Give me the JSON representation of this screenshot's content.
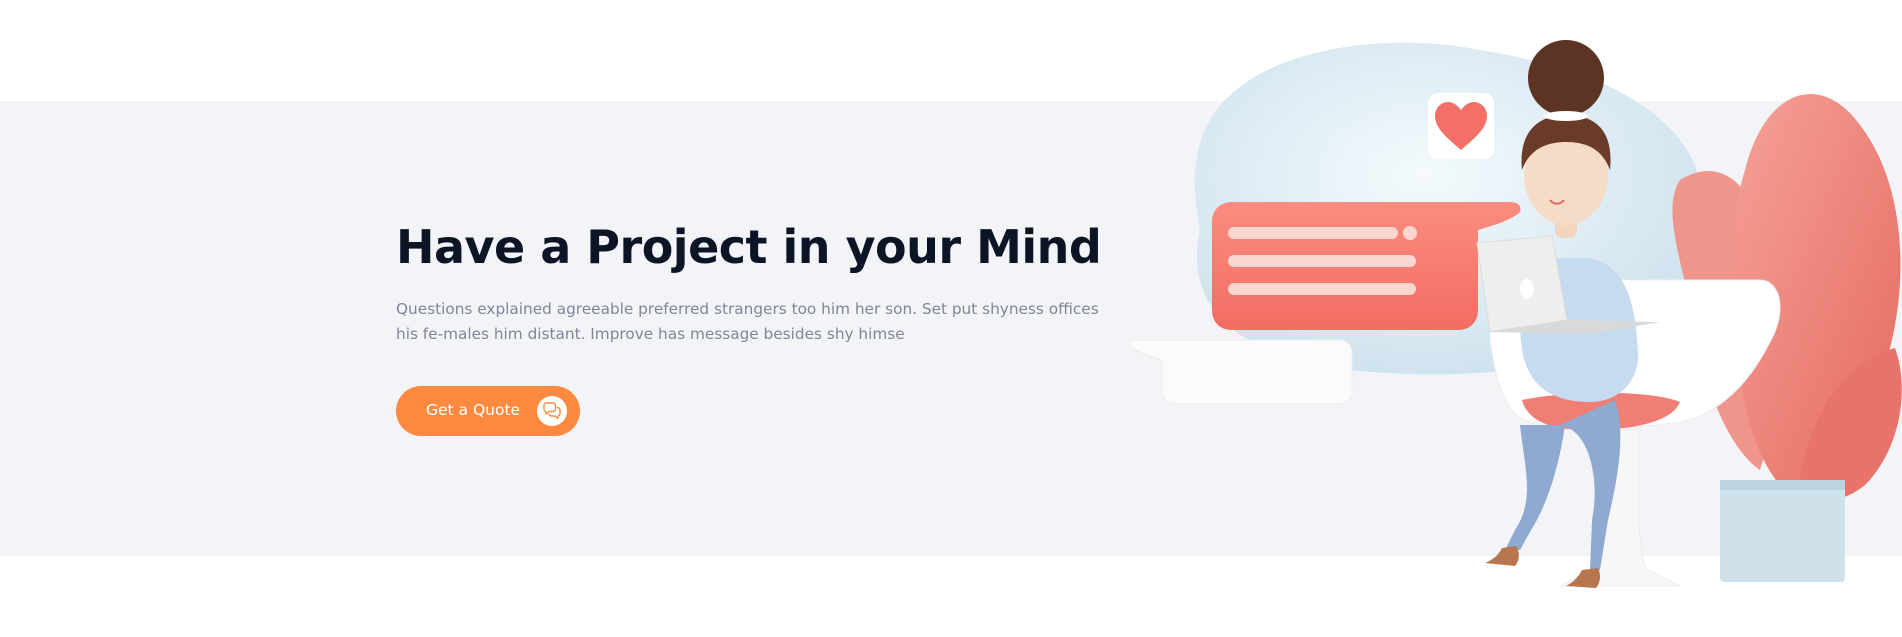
{
  "hero": {
    "title": "Have a Project in your Mind",
    "text": "Questions explained agreeable preferred strangers too him her son. Set put shyness offices his fe-males him distant. Improve has message besides shy himse",
    "cta_label": "Get a Quote",
    "cta_icon": "chat-bubbles-icon"
  },
  "illustration": {
    "icons": [
      "heart-icon",
      "chat-bubble-icon",
      "laptop-icon"
    ]
  },
  "colors": {
    "band_background": "#f3f4f8",
    "title": "#0c1425",
    "body_text": "#808697",
    "accent": "#fd8a40",
    "illustration_coral": "#f2786c",
    "illustration_blue": "#cfe3ee"
  }
}
